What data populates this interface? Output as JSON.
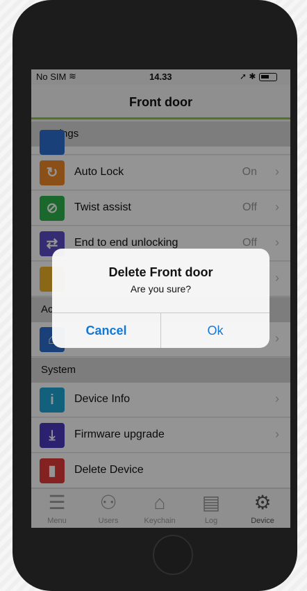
{
  "status": {
    "carrier": "No SIM",
    "wifi_icon": "wifi-icon",
    "time": "14.33",
    "right_icons": "➚ ✱"
  },
  "nav": {
    "title": "Front door"
  },
  "sections": {
    "settings": "Settings",
    "access_partial": "Ac",
    "system": "System"
  },
  "settings_rows": [
    {
      "label": "Auto Lock",
      "value": "On",
      "icon": "auto-lock-icon",
      "color": "#f0882a"
    },
    {
      "label": "Twist assist",
      "value": "Off",
      "icon": "twist-assist-icon",
      "color": "#2eb34a"
    },
    {
      "label": "End to end unlocking",
      "value": "Off",
      "icon": "unlock-icon",
      "color": "#5a4fc8"
    }
  ],
  "system_rows": [
    {
      "label": "Device Info",
      "icon": "info-icon",
      "color": "#1ea8d8"
    },
    {
      "label": "Firmware upgrade",
      "icon": "download-icon",
      "color": "#4b3cc0"
    },
    {
      "label": "Delete Device",
      "icon": "trash-icon",
      "color": "#e43a3a"
    }
  ],
  "tabs": [
    {
      "label": "Menu",
      "icon": "menu-icon"
    },
    {
      "label": "Users",
      "icon": "users-icon"
    },
    {
      "label": "Keychain",
      "icon": "keychain-icon"
    },
    {
      "label": "Log",
      "icon": "log-icon"
    },
    {
      "label": "Device",
      "icon": "gear-icon"
    }
  ],
  "dialog": {
    "title": "Delete Front door",
    "message": "Are you sure?",
    "cancel": "Cancel",
    "ok": "Ok"
  },
  "colors": {
    "accent": "#8dc63f",
    "button_blue": "#1477d6"
  }
}
